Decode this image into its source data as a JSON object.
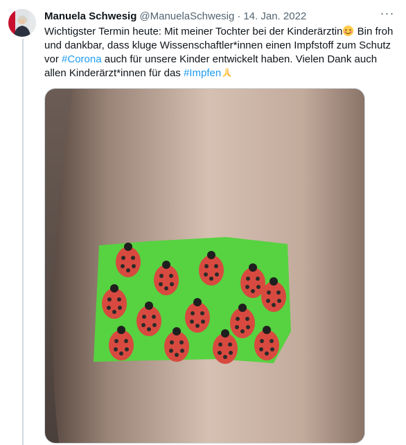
{
  "tweet": {
    "display_name": "Manuela Schwesig",
    "handle": "@ManuelaSchwesig",
    "separator": "·",
    "date": "14. Jan. 2022",
    "more_label": "···",
    "text_part1": "Wichtigster Termin heute: Mit meiner Tochter bei der Kinderärztin",
    "text_part2": " Bin froh und dankbar, dass kluge Wissenschaftler*innen einen Impfstoff zum Schutz vor ",
    "hashtag1": "#Corona",
    "text_part3": " auch für unsere Kinder entwickelt haben. Vielen Dank auch allen Kinderärzt*innen für das ",
    "hashtag2": "#Impfen",
    "emoji1": "smiling-face-icon",
    "emoji2": "folded-hands-icon"
  },
  "colors": {
    "text": "#0f1419",
    "secondary": "#536471",
    "link": "#1d9bf0",
    "border": "#cfd9de",
    "plaster_green": "#57d241",
    "ladybug_red": "#d84a3f"
  }
}
